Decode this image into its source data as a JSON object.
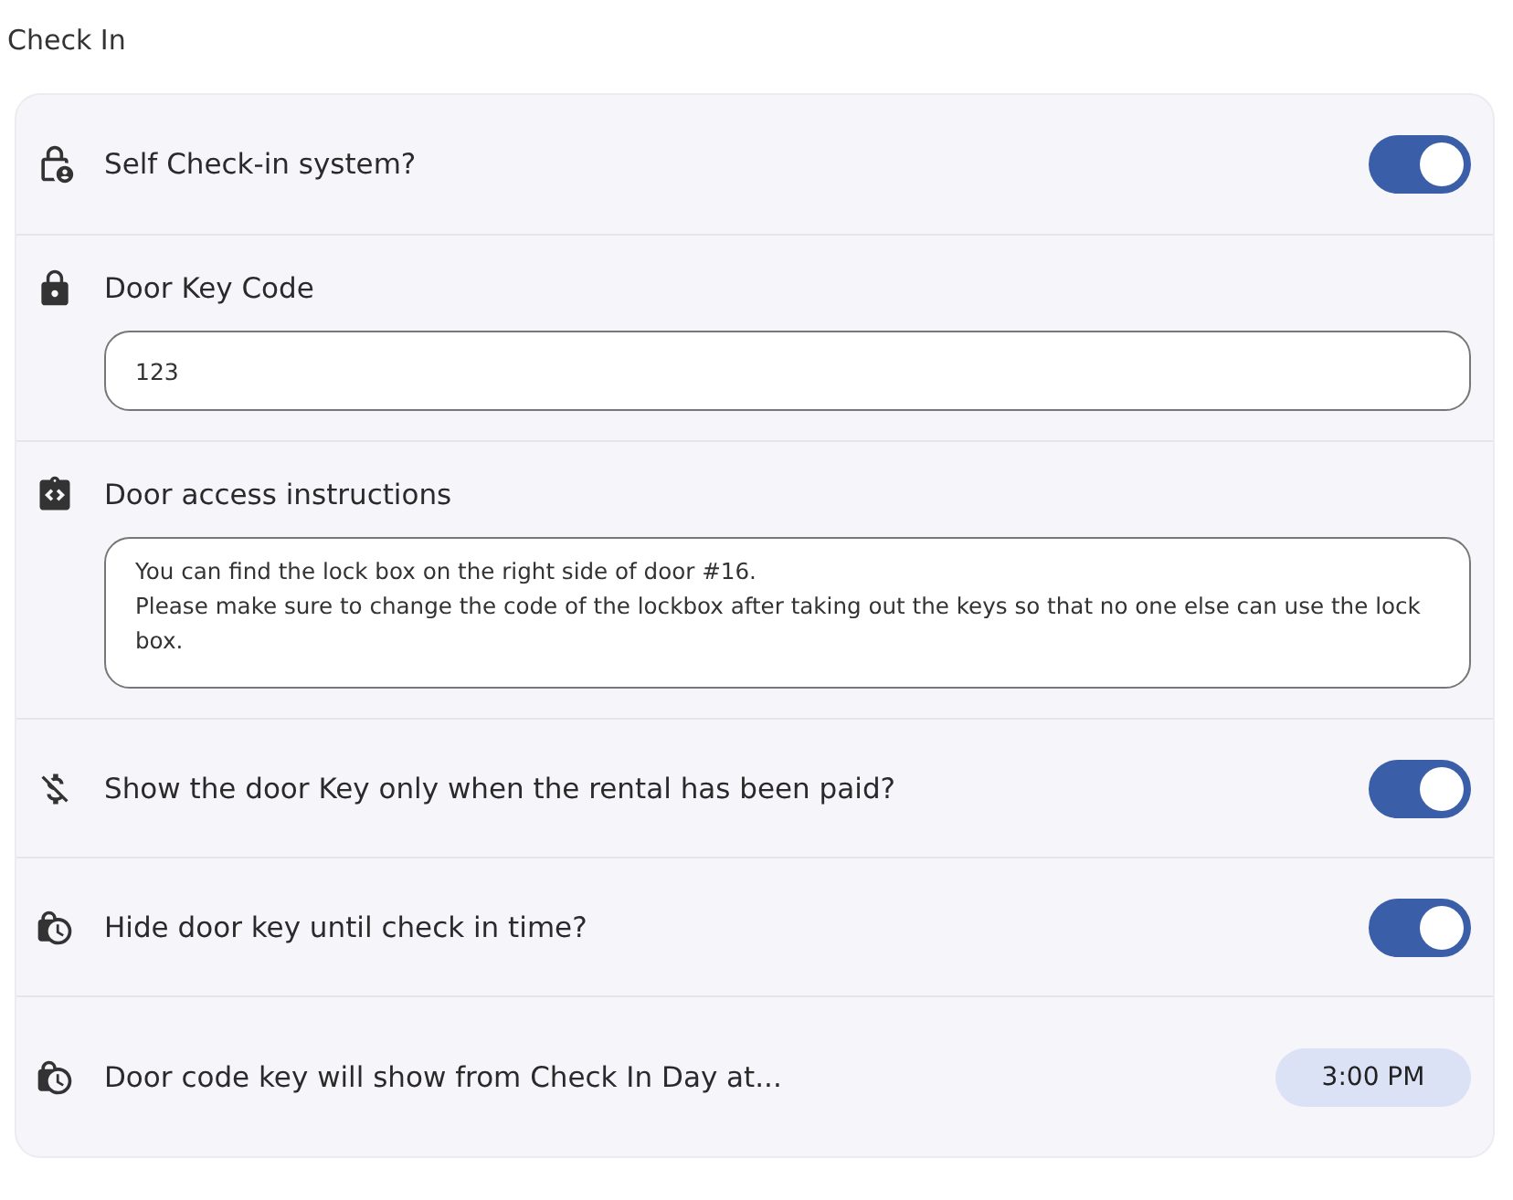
{
  "title": "Check In",
  "rows": [
    {
      "kind": "toggle",
      "label": "Self Check-in system?",
      "on": true
    },
    {
      "kind": "field",
      "label": "Door Key Code",
      "value": "123"
    },
    {
      "kind": "textarea",
      "label": "Door access instructions",
      "value": "You can find the lock box on the right side of door #16.\nPlease make sure to change the code of the lockbox after taking out the keys so that no one else can use the lock box."
    },
    {
      "kind": "toggle",
      "label": "Show the door Key only when the rental has been paid?",
      "on": true
    },
    {
      "kind": "toggle",
      "label": "Hide door key until check in time?",
      "on": true
    },
    {
      "kind": "time",
      "label": "Door code key will show from Check In Day at...",
      "value": "3:00 PM"
    }
  ]
}
